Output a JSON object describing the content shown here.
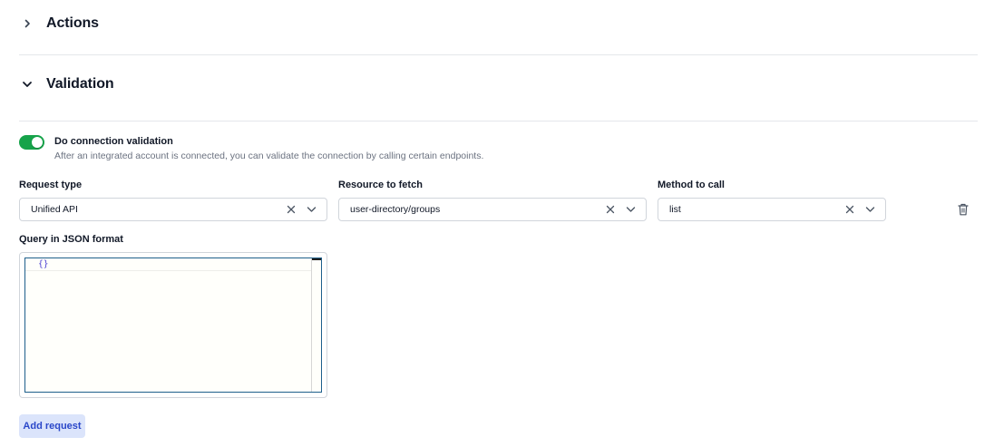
{
  "sections": {
    "actions": {
      "title": "Actions",
      "expanded": false
    },
    "validation": {
      "title": "Validation",
      "expanded": true
    }
  },
  "validation": {
    "toggle": {
      "label": "Do connection validation",
      "enabled": true,
      "color": "#16a34a"
    },
    "description": "After an integrated account is connected, you can validate the connection by calling certain endpoints.",
    "fields": {
      "request_type": {
        "label": "Request type",
        "value": "Unified API"
      },
      "resource": {
        "label": "Resource to fetch",
        "value": "user-directory/groups"
      },
      "method": {
        "label": "Method to call",
        "value": "list"
      }
    },
    "query": {
      "label": "Query in JSON format",
      "code": "{}"
    },
    "add_request_label": "Add request"
  },
  "icons": {
    "section_collapsed": "chevron-right-icon",
    "section_expanded": "chevron-down-icon",
    "clear": "close-icon",
    "dropdown": "chevron-down-icon",
    "delete": "trash-icon"
  }
}
